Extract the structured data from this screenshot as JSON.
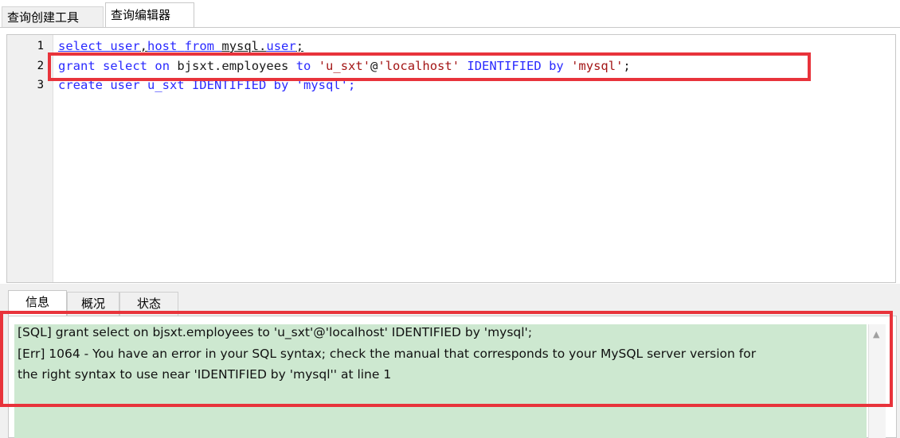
{
  "top_tabs": [
    {
      "label": "查询创建工具"
    },
    {
      "label": "查询编辑器"
    }
  ],
  "editor": {
    "line_numbers": [
      "1",
      "2",
      "3"
    ],
    "lines": [
      {
        "kw1": "select",
        "sp1": " ",
        "kw2": "user",
        "sep": ",",
        "kw3": "host",
        "sp2": " ",
        "kw4": "from",
        "sp3": " ",
        "obj": "mysql",
        "dot": ".",
        "kw5": "user",
        "semi": ";"
      },
      {
        "kw1": "grant",
        "kw2": "select",
        "kw3": "on",
        "obj": "bjsxt.employees",
        "kw4": "to",
        "str1": "'u_sxt'",
        "at": "@",
        "str2": "'localhost'",
        "kw5": "IDENTIFIED",
        "kw6": "by",
        "str3": "'mysql'",
        "semi": ";"
      },
      {
        "full": "create user u_sxt IDENTIFIED by 'mysql';"
      }
    ]
  },
  "bottom_tabs": [
    {
      "label": "信息"
    },
    {
      "label": "概况"
    },
    {
      "label": "状态"
    }
  ],
  "messages": {
    "line1": "[SQL] grant select on bjsxt.employees to 'u_sxt'@'localhost' IDENTIFIED by 'mysql';",
    "line2": "[Err] 1064 - You have an error in your SQL syntax; check the manual that corresponds to your MySQL server version for",
    "line3": "the right syntax to use near 'IDENTIFIED by 'mysql'' at line 1"
  },
  "colors": {
    "highlight_border": "#e8333b",
    "message_bg": "#cde8d0",
    "keyword": "#2a2aff"
  }
}
